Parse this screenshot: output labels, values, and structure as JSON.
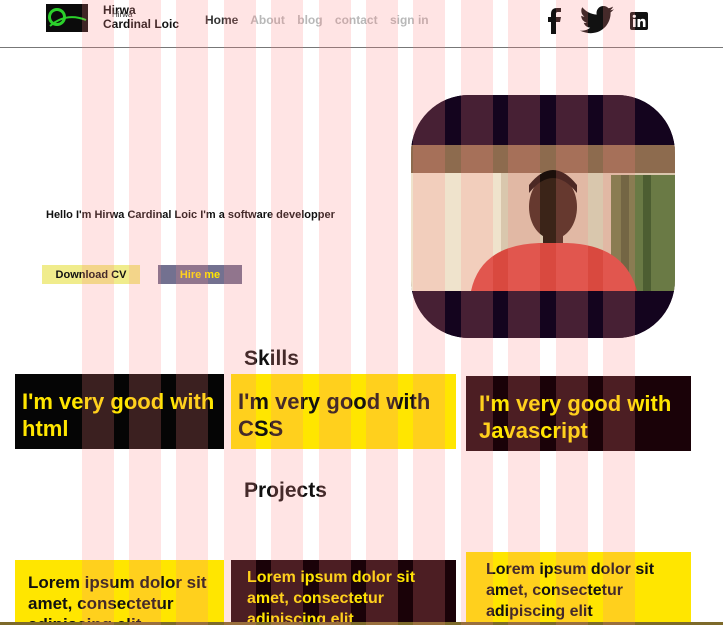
{
  "header": {
    "brand_line1": "Hirwa",
    "brand_line2": "Cardinal Loic",
    "brand_ghost": "Hirwa",
    "nav": [
      {
        "label": "Home",
        "active": true
      },
      {
        "label": "About",
        "active": false
      },
      {
        "label": "blog",
        "active": false
      },
      {
        "label": "contact",
        "active": false
      },
      {
        "label": "sign in",
        "active": false
      }
    ],
    "social_icons": [
      "facebook-icon",
      "twitter-icon",
      "linkedin-icon"
    ]
  },
  "hero": {
    "intro": "Hello I'm Hirwa  Cardinal Loic I'm a software developper",
    "download_cv": "Download CV",
    "hire_me": "Hire me"
  },
  "skills": {
    "title": "Skills",
    "cards": [
      {
        "text": "I'm very good with html"
      },
      {
        "text": "I'm very good with CSS"
      },
      {
        "text": "I'm very good with Javascript"
      }
    ]
  },
  "projects": {
    "title": "Projects",
    "cards": [
      {
        "text": "Lorem ipsum dolor sit amet, consectetur adipiscing elit"
      },
      {
        "text": "Lorem ipsum dolor sit amet, consectetur adipiscing elit"
      },
      {
        "text": "Lorem ipsum dolor sit amet, consectetur adipiscing elit"
      }
    ]
  },
  "colors": {
    "accent_yellow": "#ffe600",
    "dark": "#050505",
    "stripe": "#ff8282",
    "hire_bg": "#737190",
    "cv_bg": "#f0ec8c"
  }
}
